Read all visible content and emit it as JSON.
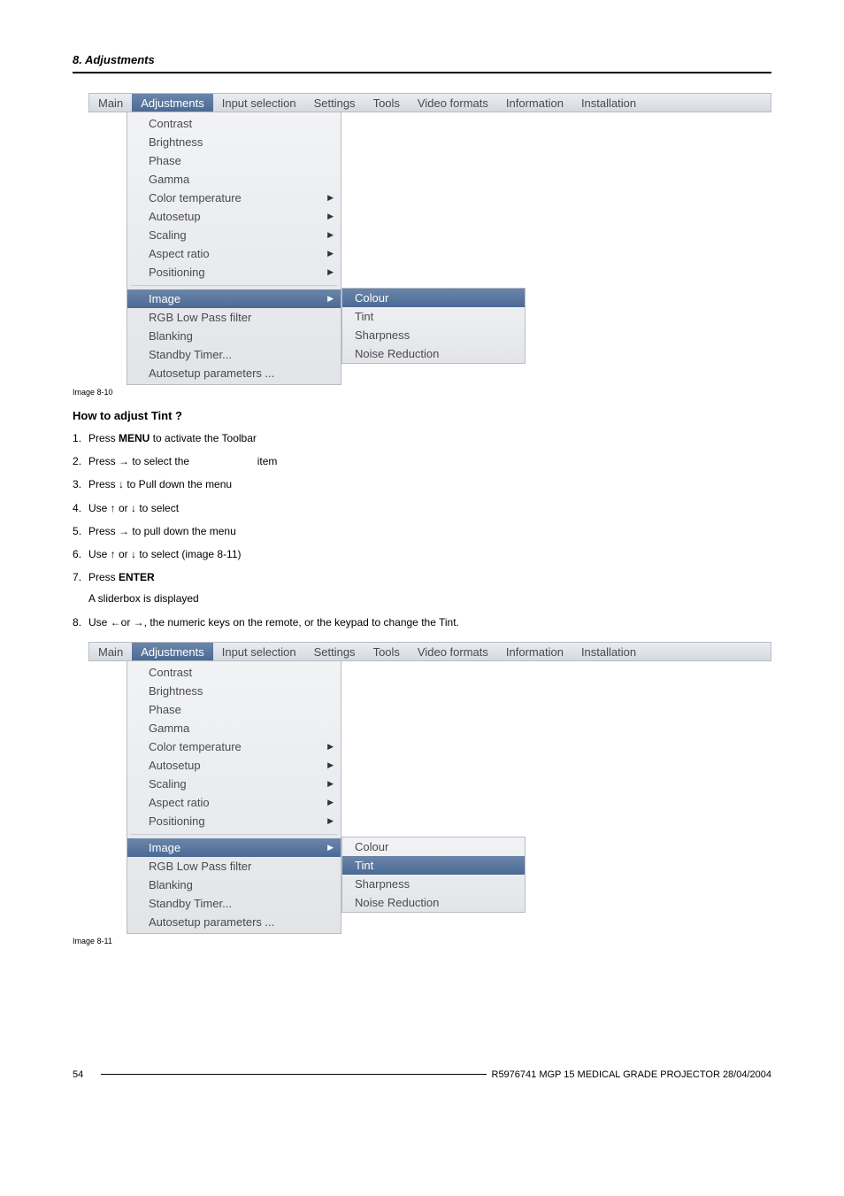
{
  "chapter": "8.  Adjustments",
  "menubar": {
    "items": [
      "Main",
      "Adjustments",
      "Input selection",
      "Settings",
      "Tools",
      "Video formats",
      "Information",
      "Installation"
    ],
    "selected_index": 1
  },
  "dropdown1": {
    "group1": [
      {
        "label": "Contrast",
        "arrow": false
      },
      {
        "label": "Brightness",
        "arrow": false
      },
      {
        "label": "Phase",
        "arrow": false
      },
      {
        "label": "Gamma",
        "arrow": false
      },
      {
        "label": "Color temperature",
        "arrow": true
      },
      {
        "label": "Autosetup",
        "arrow": true
      },
      {
        "label": "Scaling",
        "arrow": true
      },
      {
        "label": "Aspect ratio",
        "arrow": true
      },
      {
        "label": "Positioning",
        "arrow": true
      }
    ],
    "group2": [
      {
        "label": "Image",
        "arrow": true,
        "selected": true
      },
      {
        "label": "RGB Low Pass filter",
        "arrow": false
      },
      {
        "label": "Blanking",
        "arrow": false
      },
      {
        "label": "Standby Timer...",
        "arrow": false
      },
      {
        "label": "Autosetup parameters ...",
        "arrow": false
      }
    ],
    "submenu": {
      "items": [
        "Colour",
        "Tint",
        "Sharpness",
        "Noise Reduction"
      ],
      "selected_index": 0
    }
  },
  "caption1": "Image 8-10",
  "heading": "How to adjust Tint ?",
  "steps": [
    {
      "pre": "Press ",
      "bold": "MENU",
      "post": " to activate the Toolbar"
    },
    {
      "pre": "Press → to select the ",
      "italic": "",
      "gap": "                      ",
      "post": "item"
    },
    {
      "pre": "Press ↓ to Pull down the menu"
    },
    {
      "pre": "Use ↑ or ↓ to select "
    },
    {
      "pre": "Press → to pull down the menu"
    },
    {
      "pre": "Use ↑ or ↓ to select ",
      "italic2": "",
      "post": "      (image 8-11)"
    },
    {
      "pre": "Press ",
      "bold": "ENTER",
      "sub": "A sliderbox is displayed"
    },
    {
      "pre": "Use ←or →, the numeric keys on the remote, or the keypad to change the Tint."
    }
  ],
  "dropdown2": {
    "submenu": {
      "items": [
        "Colour",
        "Tint",
        "Sharpness",
        "Noise Reduction"
      ],
      "selected_index": 1
    }
  },
  "caption2": "Image 8-11",
  "footer": {
    "page": "54",
    "text": "R5976741   MGP 15 MEDICAL GRADE PROJECTOR  28/04/2004"
  }
}
